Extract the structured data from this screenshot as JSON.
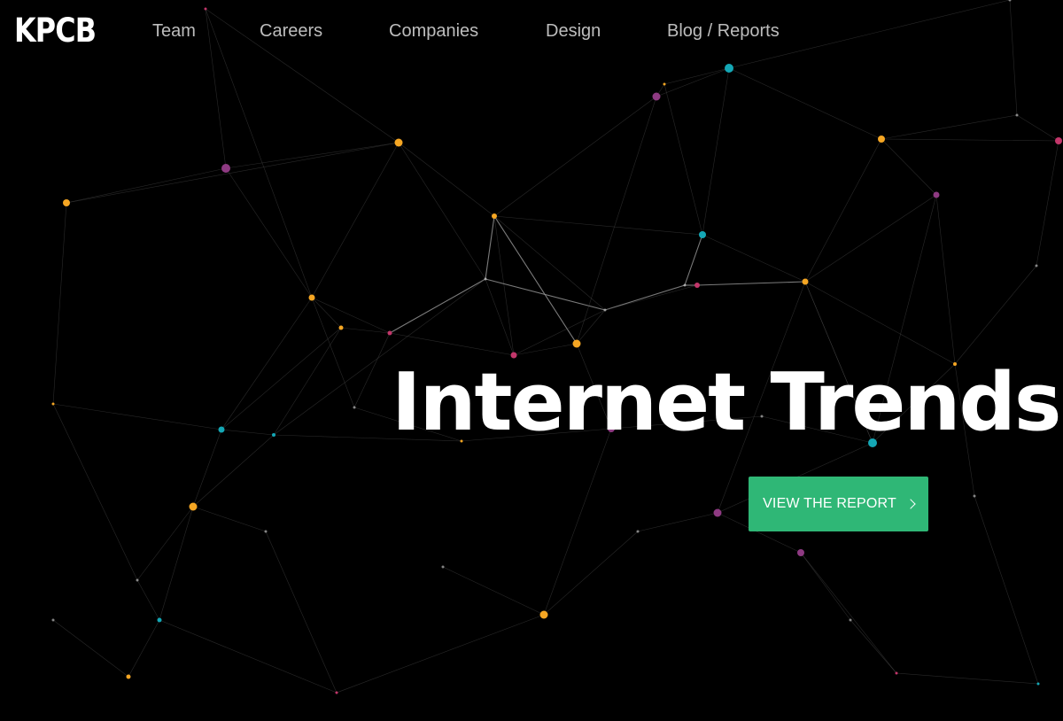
{
  "header": {
    "logo_text": "KPCB",
    "nav": [
      {
        "label": "Team"
      },
      {
        "label": "Careers"
      },
      {
        "label": "Companies"
      },
      {
        "label": "Design"
      },
      {
        "label": "Blog / Reports"
      }
    ]
  },
  "hero": {
    "title": "Internet Trends",
    "cta_label": "VIEW THE REPORT",
    "cta_icon": "chevron-right-icon"
  },
  "colors": {
    "background": "#000000",
    "cta_background": "#2fb776",
    "nav_text": "#bdbdbd",
    "node_yellow": "#f5a623",
    "node_purple": "#8e3a82",
    "node_teal": "#14a7b5",
    "node_pink": "#c2366a"
  },
  "background_graphic": "network-graph"
}
